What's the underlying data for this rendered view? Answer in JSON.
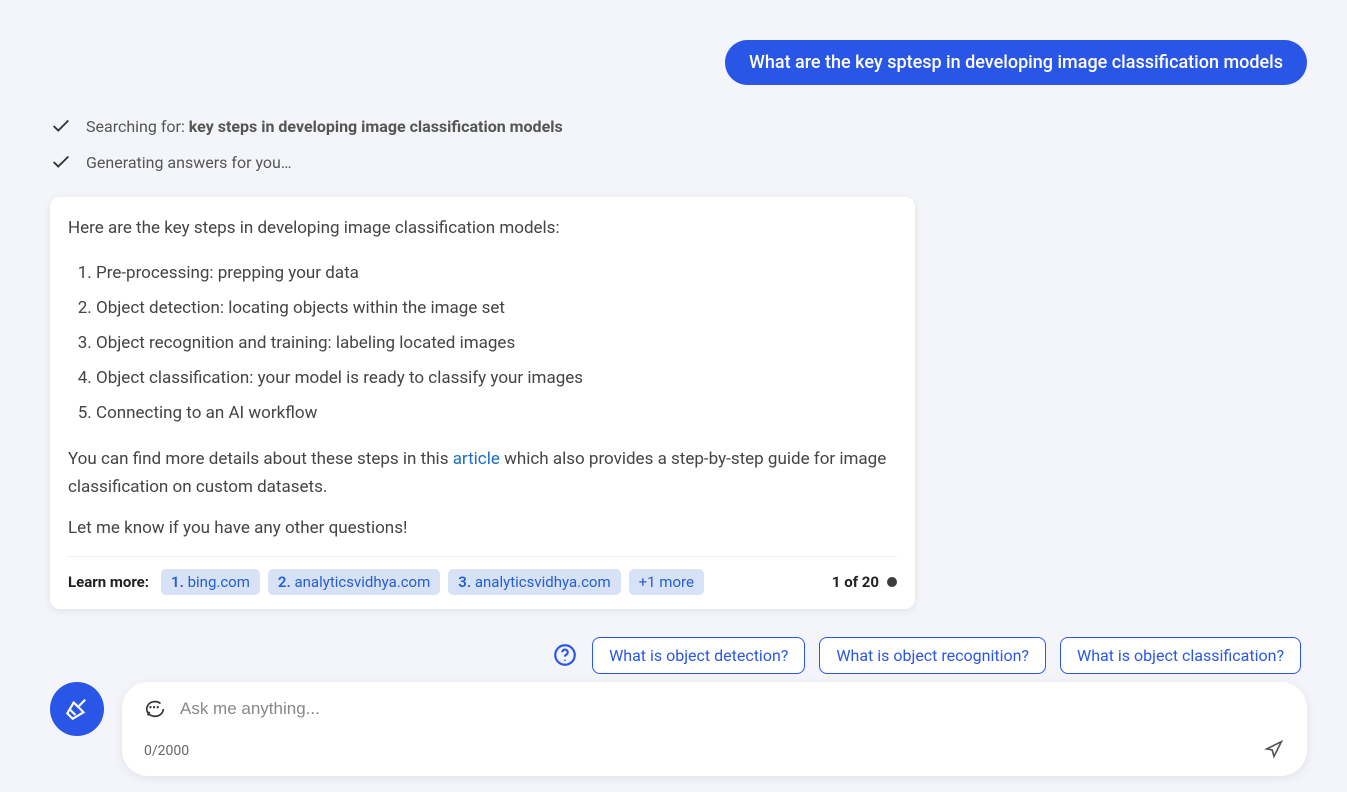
{
  "user_message": "What are the key sptesp in developing image classification models",
  "status": {
    "searching_prefix": "Searching for: ",
    "searching_query": "key steps in developing image classification models",
    "generating": "Generating answers for you…"
  },
  "response": {
    "intro": "Here are the key steps in developing image classification models:",
    "steps": [
      "Pre-processing: prepping your data",
      "Object detection: locating objects within the image set",
      "Object recognition and training: labeling located images",
      "Object classification: your model is ready to classify your images",
      "Connecting to an AI workflow"
    ],
    "more_before": "You can find more details about these steps in this ",
    "more_link": "article",
    "more_after": " which also provides a step-by-step guide for image classification on custom datasets.",
    "closing": "Let me know if you have any other questions!"
  },
  "learn": {
    "label": "Learn more:",
    "sources": [
      {
        "n": "1.",
        "host": "bing.com"
      },
      {
        "n": "2.",
        "host": "analyticsvidhya.com"
      },
      {
        "n": "3.",
        "host": "analyticsvidhya.com"
      }
    ],
    "more": "+1 more",
    "counter": "1 of 20"
  },
  "suggestions": [
    "What is object detection?",
    "What is object recognition?",
    "What is object classification?"
  ],
  "input": {
    "placeholder": "Ask me anything...",
    "counter": "0/2000"
  }
}
